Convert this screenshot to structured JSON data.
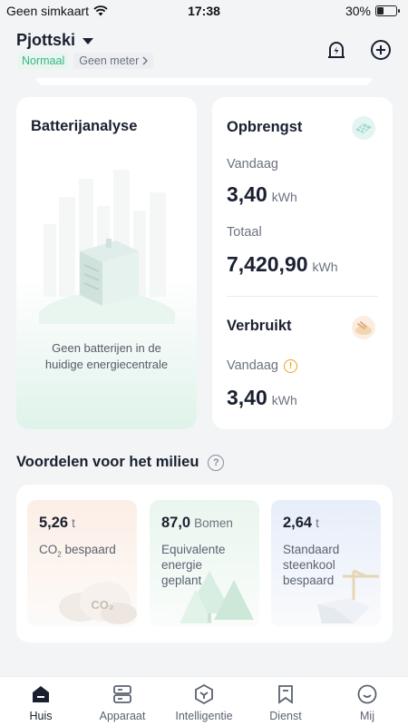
{
  "status_bar": {
    "carrier": "Geen simkaart",
    "time": "17:38",
    "battery_percent": "30%",
    "battery_level": 0.3
  },
  "header": {
    "plant_name": "Pjottski",
    "status_tag": "Normaal",
    "meter_tag": "Geen meter",
    "icons": [
      "alarm-bolt-icon",
      "add-circle-icon"
    ]
  },
  "battery_card": {
    "title": "Batterijanalyse",
    "empty_line1": "Geen batterijen in de",
    "empty_line2": "huidige energiecentrale"
  },
  "yield_card": {
    "title": "Opbrengst",
    "today_label": "Vandaag",
    "today_value": "3,40",
    "today_unit": "kWh",
    "total_label": "Totaal",
    "total_value": "7,420,90",
    "total_unit": "kWh"
  },
  "consumption_card": {
    "title": "Verbruikt",
    "today_label": "Vandaag",
    "today_value": "3,40",
    "today_unit": "kWh"
  },
  "environment": {
    "title": "Voordelen voor het milieu",
    "tiles": [
      {
        "value": "5,26",
        "unit": "t",
        "desc": "CO",
        "desc_sub": "2",
        "desc_rest": " bespaard",
        "art_label": "CO₂"
      },
      {
        "value": "87,0",
        "unit": "Bomen",
        "desc_lines": [
          "Equivalente",
          "energie",
          "geplant"
        ]
      },
      {
        "value": "2,64",
        "unit": "t",
        "desc_lines": [
          "Standaard",
          "steenkool",
          "bespaard"
        ]
      }
    ]
  },
  "tabbar": {
    "active": "Huis",
    "tabs": [
      {
        "label": "Huis",
        "icon": "home-icon"
      },
      {
        "label": "Apparaat",
        "icon": "device-icon"
      },
      {
        "label": "Intelligentie",
        "icon": "intelligence-icon"
      },
      {
        "label": "Dienst",
        "icon": "service-bookmark-icon"
      },
      {
        "label": "Mij",
        "icon": "profile-smiley-icon"
      }
    ]
  },
  "colors": {
    "accent_green": "#3bb38a",
    "warning_orange": "#f0a020",
    "text_dark": "#1a2030",
    "background": "#f2f4f6"
  }
}
